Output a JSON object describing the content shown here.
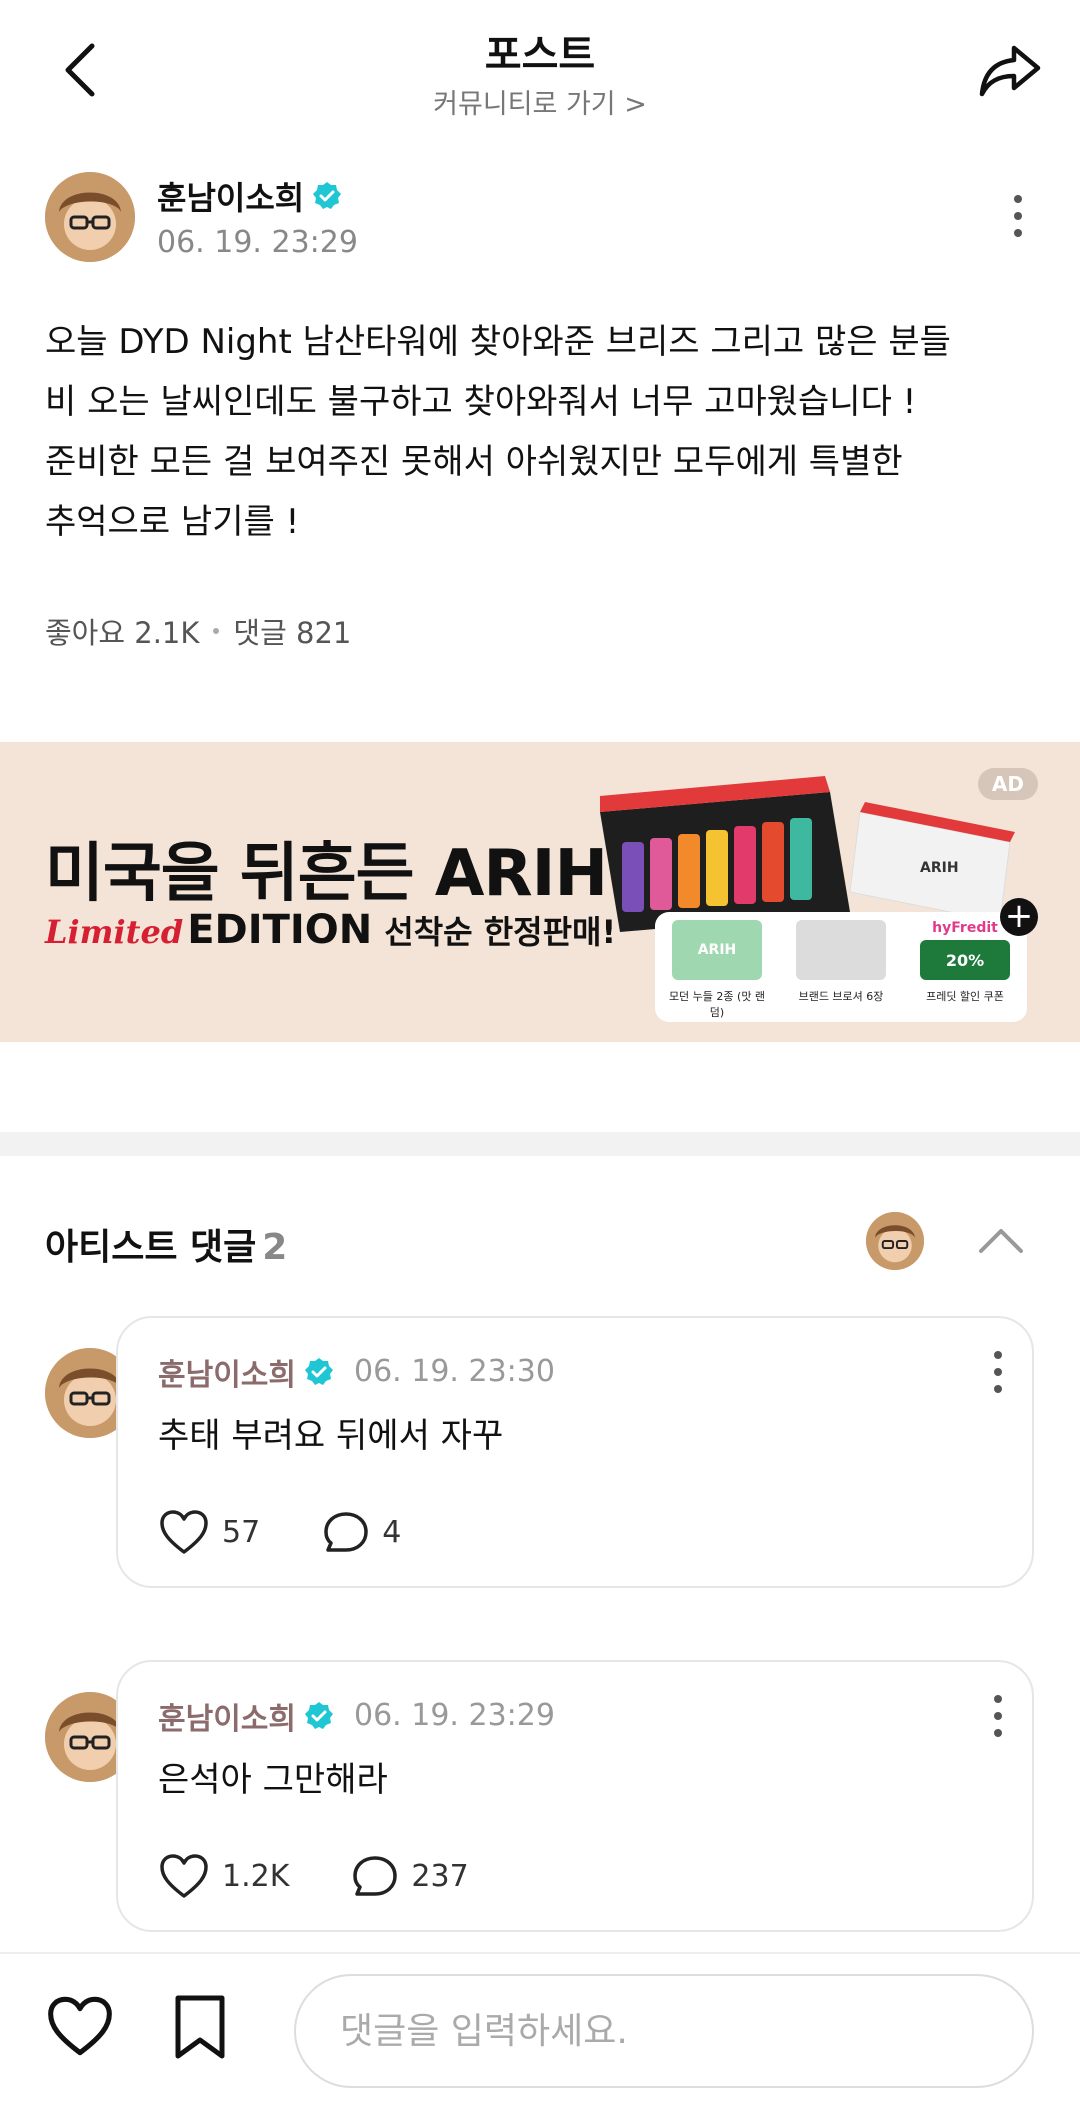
{
  "header": {
    "title": "포스트",
    "subtitle": "커뮤니티로 가기 >"
  },
  "post": {
    "author": "훈남이소희",
    "date": "06. 19. 23:29",
    "body": "오늘 DYD Night 남산타워에 찾아와준 브리즈 그리고 많은 분들\n비 오는 날씨인데도 불구하고 찾아와줘서 너무 고마웠습니다 !\n준비한 모든 걸 보여주진 못해서 아쉬웠지만 모두에게 특별한\n추억으로 남기를 !",
    "likes_label": "좋아요",
    "likes": "2.1K",
    "comments_label": "댓글",
    "comments": "821"
  },
  "ad": {
    "badge": "AD",
    "headline": "미국을 뒤흔든 ARIH",
    "limited": "Limited",
    "edition": "EDITION",
    "tagline": "선착순 한정판매!",
    "brand_box": "ARIH",
    "cards": [
      {
        "label": "모던 누들 2종 (맛 랜덤)",
        "thumb_text": "ARIH"
      },
      {
        "label": "브랜드 브로셔 6장",
        "thumb_text": ""
      },
      {
        "label": "프레딧 할인 쿠폰",
        "thumb_text": "20%",
        "brand": "hyFredit"
      }
    ]
  },
  "artist_comments": {
    "title": "아티스트 댓글",
    "count": "2",
    "items": [
      {
        "author": "훈남이소희",
        "date": "06. 19. 23:30",
        "text": "추태 부려요 뒤에서 자꾸",
        "likes": "57",
        "replies": "4"
      },
      {
        "author": "훈남이소희",
        "date": "06. 19. 23:29",
        "text": "은석아 그만해라",
        "likes": "1.2K",
        "replies": "237"
      }
    ]
  },
  "composer": {
    "placeholder": "댓글을 입력하세요."
  },
  "colors": {
    "verified": "#1fc7d4",
    "ad_bg": "#f3e4d7",
    "name_muted": "#8b6b6b"
  },
  "icons": [
    "back-arrow-icon",
    "share-icon",
    "verified-icon",
    "more-icon",
    "heart-icon",
    "comment-icon",
    "bookmark-icon",
    "chevron-up-icon",
    "plus-icon"
  ]
}
